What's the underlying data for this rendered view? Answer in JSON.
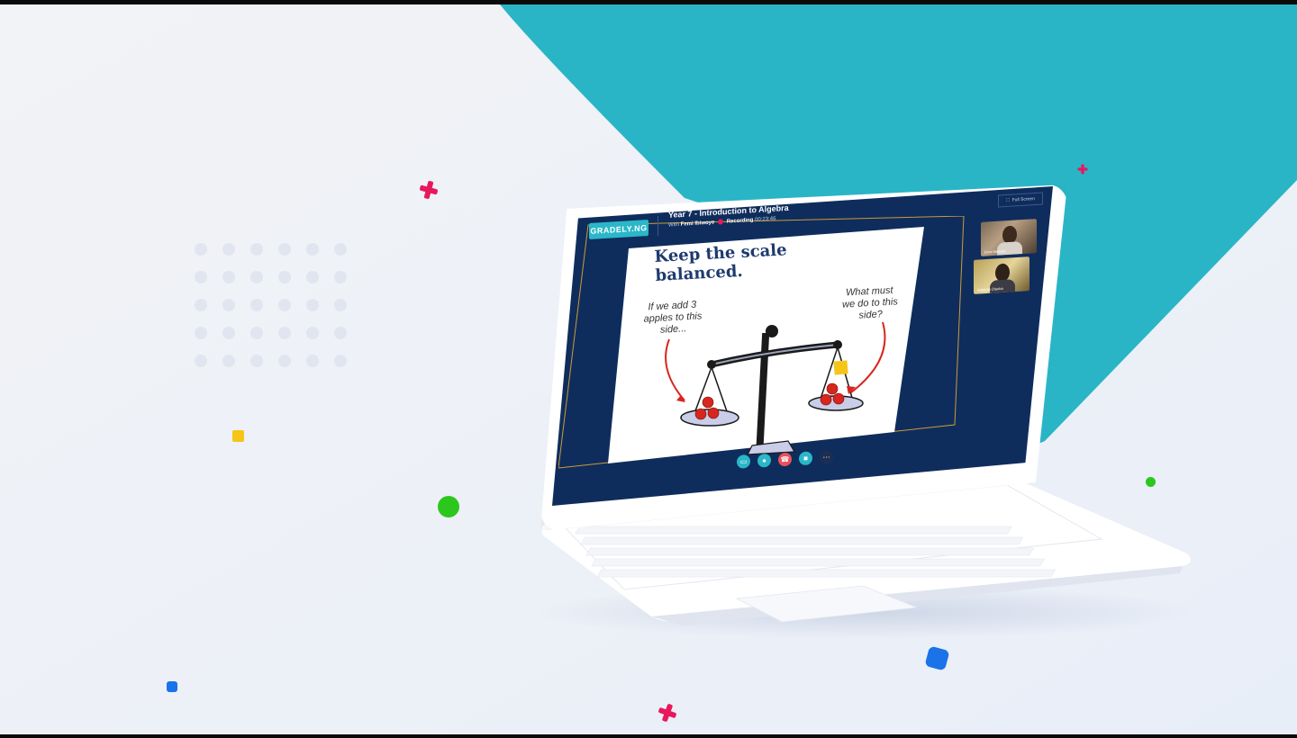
{
  "app": {
    "brand": "GRADELY.NG",
    "class_title": "Year 7 - Introduction to Algebra",
    "teacher_prefix": "With",
    "teacher_name": "Femi Ibiwoye",
    "recording_label": "Recording",
    "recording_time": "00:23:46",
    "full_screen_label": "Full Screen"
  },
  "participants": [
    {
      "name": "Femi Ibiwoye"
    },
    {
      "name": "Adebola Olaoba"
    }
  ],
  "slide": {
    "title": "Keep the scale balanced.",
    "left_note_lines": [
      "If we add 3",
      "apples to this",
      "side..."
    ],
    "right_note_lines": [
      "What must",
      "we do to this",
      "side?"
    ]
  },
  "controls": [
    {
      "icon": "screen-share-icon",
      "color": "#2ab7c9"
    },
    {
      "icon": "microphone-icon",
      "color": "#2ab7c9"
    },
    {
      "icon": "end-call-icon",
      "color": "#e8515c"
    },
    {
      "icon": "camera-icon",
      "color": "#2ab7c9"
    },
    {
      "icon": "more-icon",
      "color": "#1c2f52"
    }
  ],
  "colors": {
    "teal": "#2ab7c9",
    "navy": "#0f2d5c",
    "pink": "#e8185c",
    "green": "#2bc71d",
    "yellow": "#f5c518",
    "blue": "#1a73e8"
  }
}
